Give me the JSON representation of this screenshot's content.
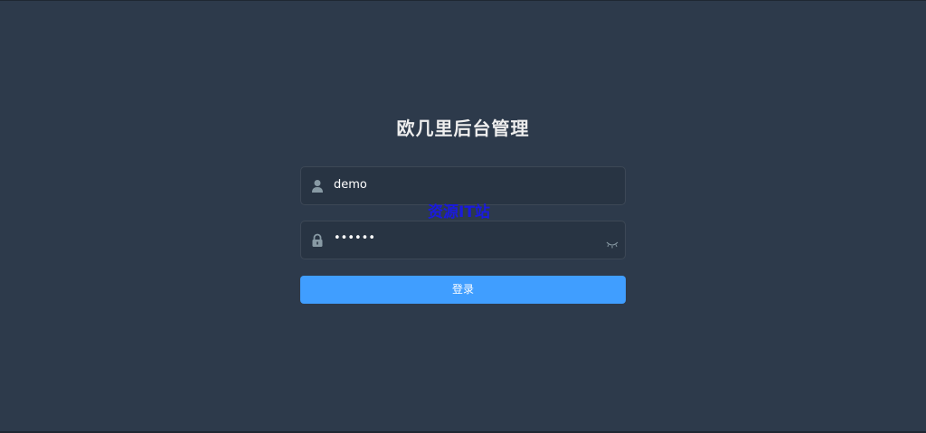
{
  "title": "欧几里后台管理",
  "username": {
    "value": "demo",
    "icon": "user-icon"
  },
  "password": {
    "value": "••••••",
    "icon": "lock-icon",
    "toggle_icon": "eye-closed-icon"
  },
  "watermark": "资源IT站",
  "login_button": {
    "label": "登录"
  },
  "colors": {
    "background": "#2d3a4b",
    "field_background": "#283443",
    "button": "#409eff",
    "title_text": "#eeeeee",
    "watermark": "#1a1adf"
  }
}
